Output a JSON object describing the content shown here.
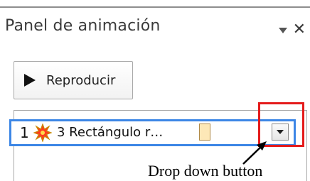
{
  "panel": {
    "title": "Panel de animación",
    "menu_icon": "triangle-down-icon",
    "close_label": "✕"
  },
  "play_button": {
    "label": "Reproducir",
    "icon": "play-icon"
  },
  "animation_list": {
    "items": [
      {
        "order": "1",
        "effect_icon": "starburst-effect-icon",
        "label": "3 Rectángulo r…",
        "swatch_color": "#fde8b7"
      }
    ]
  },
  "annotation": {
    "text": "Drop down button",
    "highlight_color": "#e41b1b"
  },
  "colors": {
    "selection_border": "#3c86e6",
    "star_fill": "#ff3b1f",
    "star_outline": "#c98a00"
  }
}
